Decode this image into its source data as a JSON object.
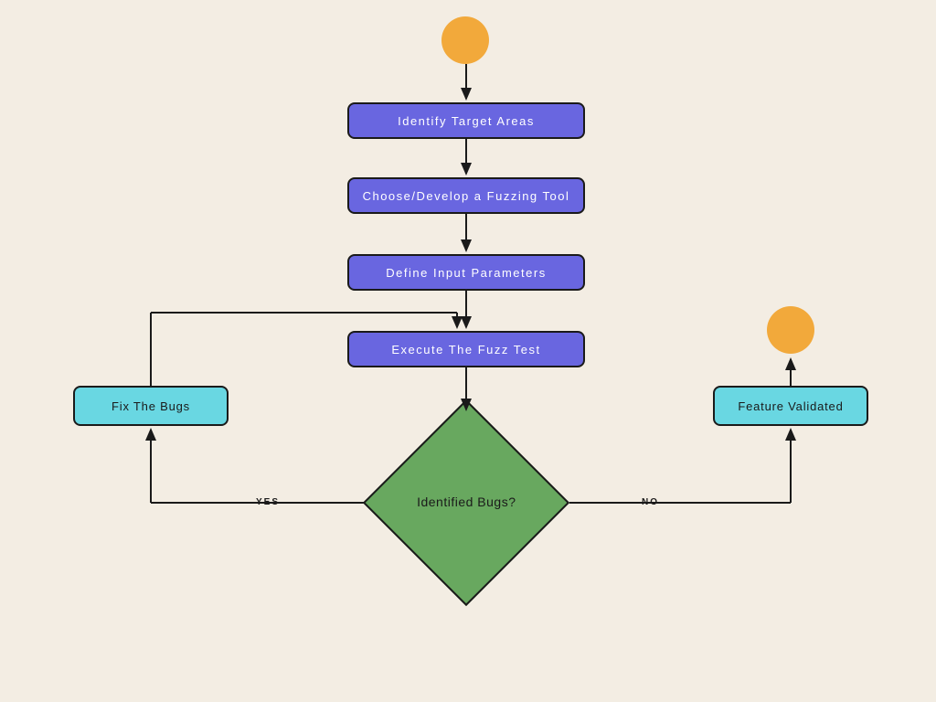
{
  "nodes": {
    "step1": "Identify Target Areas",
    "step2": "Choose/Develop a Fuzzing Tool",
    "step3": "Define Input Parameters",
    "step4": "Execute The Fuzz Test",
    "decision": "Identified Bugs?",
    "fix": "Fix The Bugs",
    "validated": "Feature Validated"
  },
  "edges": {
    "yes": "YES",
    "no": "NO"
  },
  "colors": {
    "background": "#f3ede3",
    "process": "#6966e0",
    "side": "#69d7e2",
    "decision": "#68a85f",
    "terminator": "#f2a93b",
    "stroke": "#1a1a1a"
  }
}
